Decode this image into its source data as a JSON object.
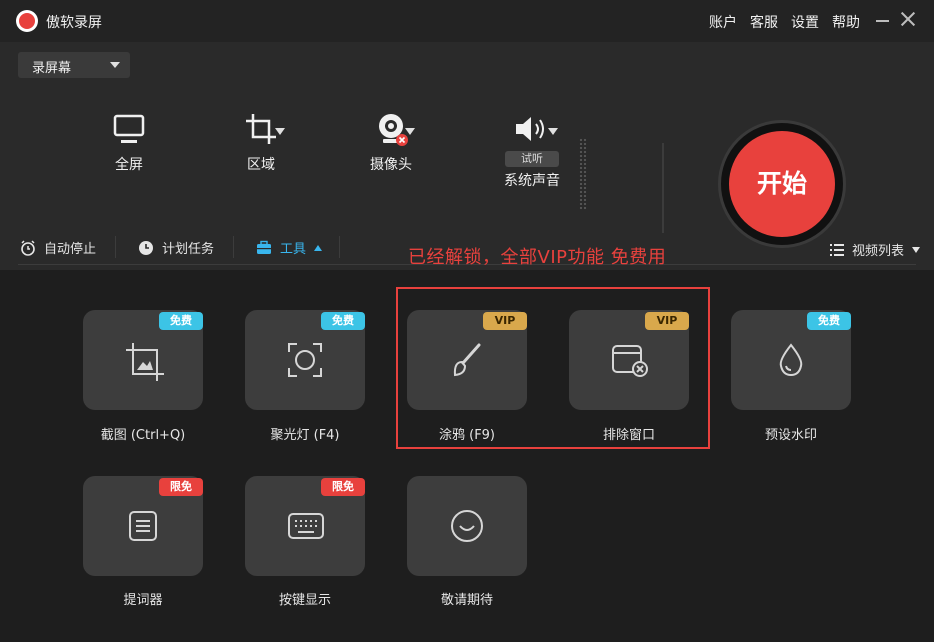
{
  "app": {
    "title": "傲软录屏"
  },
  "top_links": [
    "账户",
    "客服",
    "设置",
    "帮助"
  ],
  "mode_select": {
    "value": "录屏幕"
  },
  "sources": {
    "fullscreen": "全屏",
    "region": "区域",
    "webcam": "摄像头",
    "system_audio": "系统声音",
    "test_listen": "试听"
  },
  "start_button": "开始",
  "toolbar": {
    "auto_stop": "自动停止",
    "schedule": "计划任务",
    "tools": "工具",
    "unlock_notice": "已经解锁，全部VIP功能 免费用",
    "video_list": "视频列表"
  },
  "tools": [
    {
      "label": "截图 (Ctrl+Q)",
      "badge": "免费",
      "icon": "crop-image-icon"
    },
    {
      "label": "聚光灯 (F4)",
      "badge": "免费",
      "icon": "spotlight-icon"
    },
    {
      "label": "涂鸦 (F9)",
      "badge": "VIP",
      "icon": "brush-icon"
    },
    {
      "label": "排除窗口",
      "badge": "VIP",
      "icon": "exclude-window-icon"
    },
    {
      "label": "预设水印",
      "badge": "免费",
      "icon": "watermark-drop-icon"
    },
    {
      "label": "提词器",
      "badge": "限免",
      "icon": "teleprompter-icon"
    },
    {
      "label": "按键显示",
      "badge": "限免",
      "icon": "keyboard-icon"
    },
    {
      "label": "敬请期待",
      "badge": "",
      "icon": "coming-soon-icon"
    }
  ],
  "colors": {
    "accent_red": "#e8413d",
    "accent_blue": "#39b6ee",
    "free_badge": "#3cc4e6",
    "vip_badge": "#d9a84c"
  }
}
